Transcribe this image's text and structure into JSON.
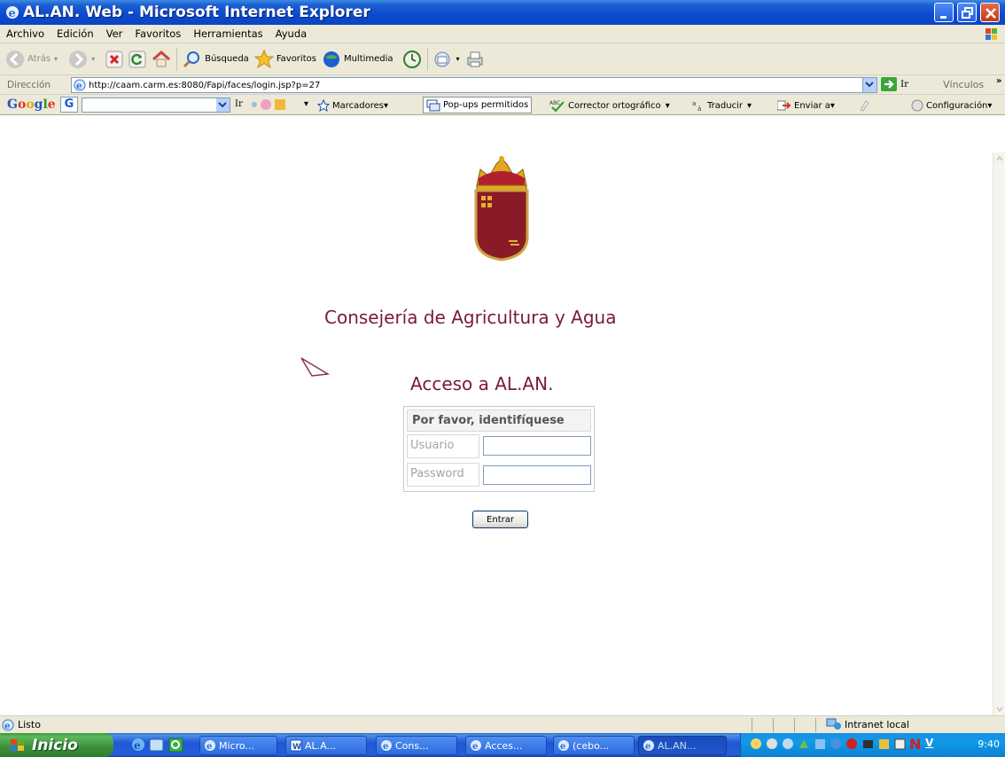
{
  "window": {
    "title": "AL.AN. Web - Microsoft Internet Explorer"
  },
  "menu": {
    "items": [
      "Archivo",
      "Edición",
      "Ver",
      "Favoritos",
      "Herramientas",
      "Ayuda"
    ]
  },
  "toolbar": {
    "back_label": "Atrás",
    "search_label": "Búsqueda",
    "favorites_label": "Favoritos",
    "multimedia_label": "Multimedia"
  },
  "address": {
    "label": "Dirección",
    "url": "http://caam.carm.es:8080/Fapi/faces/login.jsp?p=27",
    "go_label": "Ir",
    "links_label": "Vínculos"
  },
  "google_toolbar": {
    "logo": "Google",
    "search_go": "Ir",
    "bookmarks": "Marcadores",
    "popups": "Pop-ups permitidos",
    "spellcheck": "Corrector ortográfico",
    "translate": "Traducir",
    "send": "Enviar a",
    "settings": "Configuración"
  },
  "page": {
    "heading": "Consejería de Agricultura y Agua",
    "subheading": "Acceso a AL.AN.",
    "login": {
      "header": "Por favor, identifíquese",
      "user_label": "Usuario",
      "user_value": "",
      "password_label": "Password",
      "password_value": "",
      "submit_label": "Entrar"
    }
  },
  "status": {
    "text": "Listo",
    "zone": "Intranet local"
  },
  "taskbar": {
    "start_label": "Inicio",
    "tasks": [
      "Micro...",
      "AL.A...",
      "Cons...",
      "Acces...",
      "(cebo...",
      "AL.AN..."
    ],
    "clock": "9:40"
  },
  "colors": {
    "accent": "#7a1a3a",
    "titlebar": "#0a4ad0",
    "chrome": "#ece9d8"
  }
}
